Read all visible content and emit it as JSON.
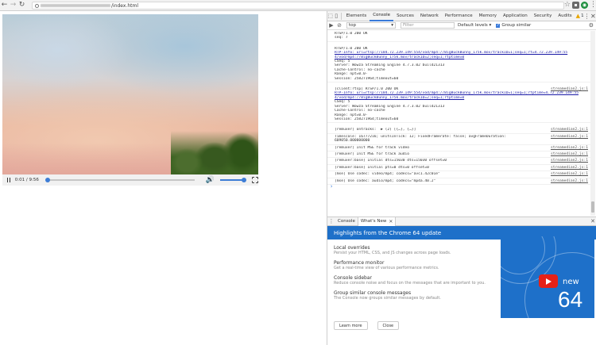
{
  "browser": {
    "url_path": "/index.html",
    "back_icon": "arrow-left-icon",
    "forward_icon": "arrow-right-icon",
    "reload_icon": "reload-icon"
  },
  "video": {
    "time": "0:01 / 9:56",
    "progress": 0.003,
    "volume": 1.0
  },
  "devtools": {
    "tabs": [
      "Elements",
      "Console",
      "Sources",
      "Network",
      "Performance",
      "Memory",
      "Application",
      "Security",
      "Audits"
    ],
    "active_tab": "Console",
    "warn_count": "1",
    "context": "top",
    "filter_placeholder": "Filter",
    "levels": "Default levels ▾",
    "group_similar": "Group similar"
  },
  "console": {
    "block1": [
      "RTSP/1.0 200 OK",
      "seq: 7"
    ],
    "block2": [
      "RTSP/1.0 200 OK",
      "RTP-Info: url=rtsp://184.72.239.149:554/vod/mp4://BigBuckBunny_175k.mov/trackID=1;seq=1;rt=4.72.239.149:55",
      "4/vod/mp4://BigBuckBunny_175k.mov/trackID=2;seq=1;rtptime=0",
      "CSeq: 5",
      "Server: Wowza Streaming Engine 4.7.3.02 build21313",
      "Cache-Control: no-cache",
      "Range: npt=0.0-",
      "Session: 258271964;timeout=60"
    ],
    "block3_first": "[client:rtsp] RTSP/1.0 200 OK",
    "block3": [
      "RTP-Info: url=rtsp://184.72.239.149:554/vod/mp4://BigBuckBunny_175k.mov/trackID=1;seq=1;rtptime=4.72.239.149:55",
      "4/vod/mp4://BigBuckBunny_175k.mov/trackID=2;seq=1;rtptime=0",
      "CSeq: 5",
      "Server: Wowza Streaming Engine 4.7.3.02 build21313",
      "Cache-Control: no-cache",
      "Range: npt=0.0-",
      "Session: 258271964;timeout=60"
    ],
    "entries": [
      {
        "text": "[remuxer] ontracks:  ▶ (2) [{…}, {…}]",
        "src": "streamedian2.js:1"
      },
      {
        "text": "Timescale: 16777216; unitsInTick: 12; FixedFramerate: false; avgFrameDuration:\n609050.000000000",
        "src": "streamedian2.js:1"
      },
      {
        "text": "[remuxer] Init MSE for track video",
        "src": "streamedian2.js:1"
      },
      {
        "text": "[remuxer] Init MSE for track audio",
        "src": "streamedian2.js:1"
      },
      {
        "text": "[remuxer:base] Initial dts=15030 dts=15030 offset=0",
        "src": "streamedian2.js:1"
      },
      {
        "text": "[remuxer:base] Initial pts=0 dts=0 offset=0",
        "src": "streamedian2.js:1"
      },
      {
        "text": "[mse] Use codec: video/mp4; codecs=\"avc1.42c01e\"",
        "src": "streamedian2.js:1"
      },
      {
        "text": "[mse] Use codec: audio/mp4; codecs=\"mp4a.40.2\"",
        "src": "streamedian2.js:1"
      }
    ],
    "src_label": "streamedian2.js:1"
  },
  "drawer": {
    "tabs": [
      "Console",
      "What's New"
    ],
    "active_tab": "What's New",
    "banner": "Highlights from the Chrome 64 update",
    "items": [
      {
        "title": "Local overrides",
        "desc": "Persist your HTML, CSS, and JS changes across page loads."
      },
      {
        "title": "Performance monitor",
        "desc": "Get a real-time view of various performance metrics."
      },
      {
        "title": "Console sidebar",
        "desc": "Reduce console noise and focus on the messages that are important to you."
      },
      {
        "title": "Group similar console messages",
        "desc": "The Console now groups similar messages by default."
      }
    ],
    "learn_more": "Learn more",
    "close": "Close",
    "promo_new": "new",
    "promo_num": "64"
  }
}
